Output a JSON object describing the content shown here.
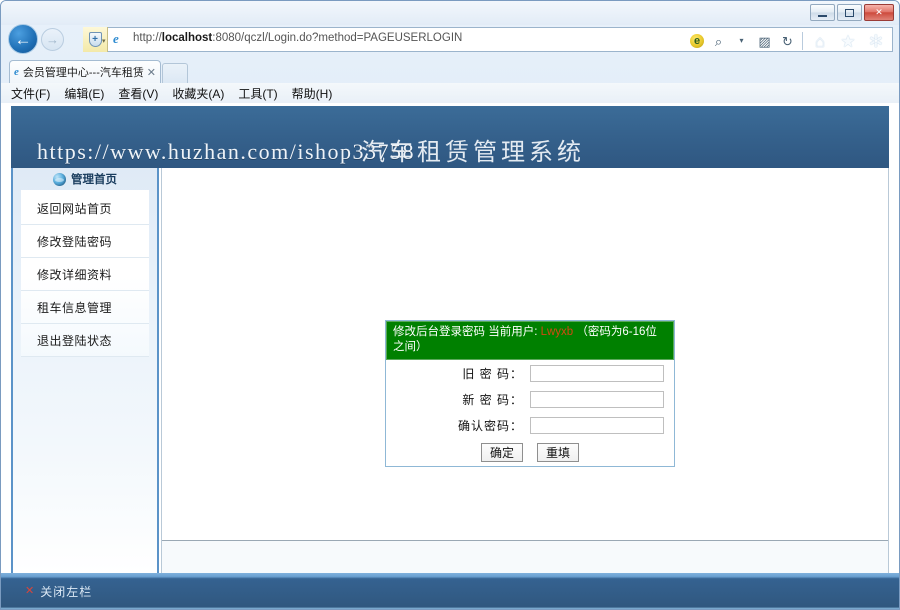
{
  "window": {
    "minimize_label": "Minimize",
    "maximize_label": "Maximize",
    "close_label": "✕"
  },
  "browser": {
    "back_label": "←",
    "forward_label": "→",
    "shield_label": "+",
    "shield_caret": "▾",
    "favicon_label": "e",
    "url_prefix": "http://",
    "url_host": "localhost",
    "url_rest": ":8080/qczl/Login.do?method=PAGEUSERLOGIN",
    "icons": {
      "compat_view": "e",
      "search": "⌕",
      "search_caret": "▾",
      "broken_image": "▨",
      "refresh": "↻",
      "home": "⌂",
      "favorites": "★",
      "tools": "✲"
    },
    "tab": {
      "favicon_label": "e",
      "title": "会员管理中心---汽车租赁...",
      "close_label": "✕"
    },
    "menu": [
      {
        "label": "文件(F)"
      },
      {
        "label": "编辑(E)"
      },
      {
        "label": "查看(V)"
      },
      {
        "label": "收藏夹(A)"
      },
      {
        "label": "工具(T)"
      },
      {
        "label": "帮助(H)"
      }
    ]
  },
  "page": {
    "banner": {
      "watermark": "https://www.huzhan.com/ishop33758",
      "title": "汽车租赁管理系统"
    },
    "sidebar": {
      "header_label": "管理首页",
      "header_icon": "globe-icon",
      "items": [
        {
          "label": "返回网站首页"
        },
        {
          "label": "修改登陆密码"
        },
        {
          "label": "修改详细资料"
        },
        {
          "label": "租车信息管理"
        },
        {
          "label": "退出登陆状态"
        }
      ]
    },
    "form": {
      "header_title": "修改后台登录密码  当前用户:",
      "header_user": "Lwyxb",
      "header_note": "（密码为6-16位之间）",
      "rows": [
        {
          "label": "旧 密 码：",
          "value": ""
        },
        {
          "label": "新 密 码：",
          "value": ""
        },
        {
          "label": "确认密码：",
          "value": ""
        }
      ],
      "submit_label": "确定",
      "reset_label": "重填"
    }
  },
  "statusbar": {
    "close_icon": "✕",
    "label": "关闭左栏"
  }
}
